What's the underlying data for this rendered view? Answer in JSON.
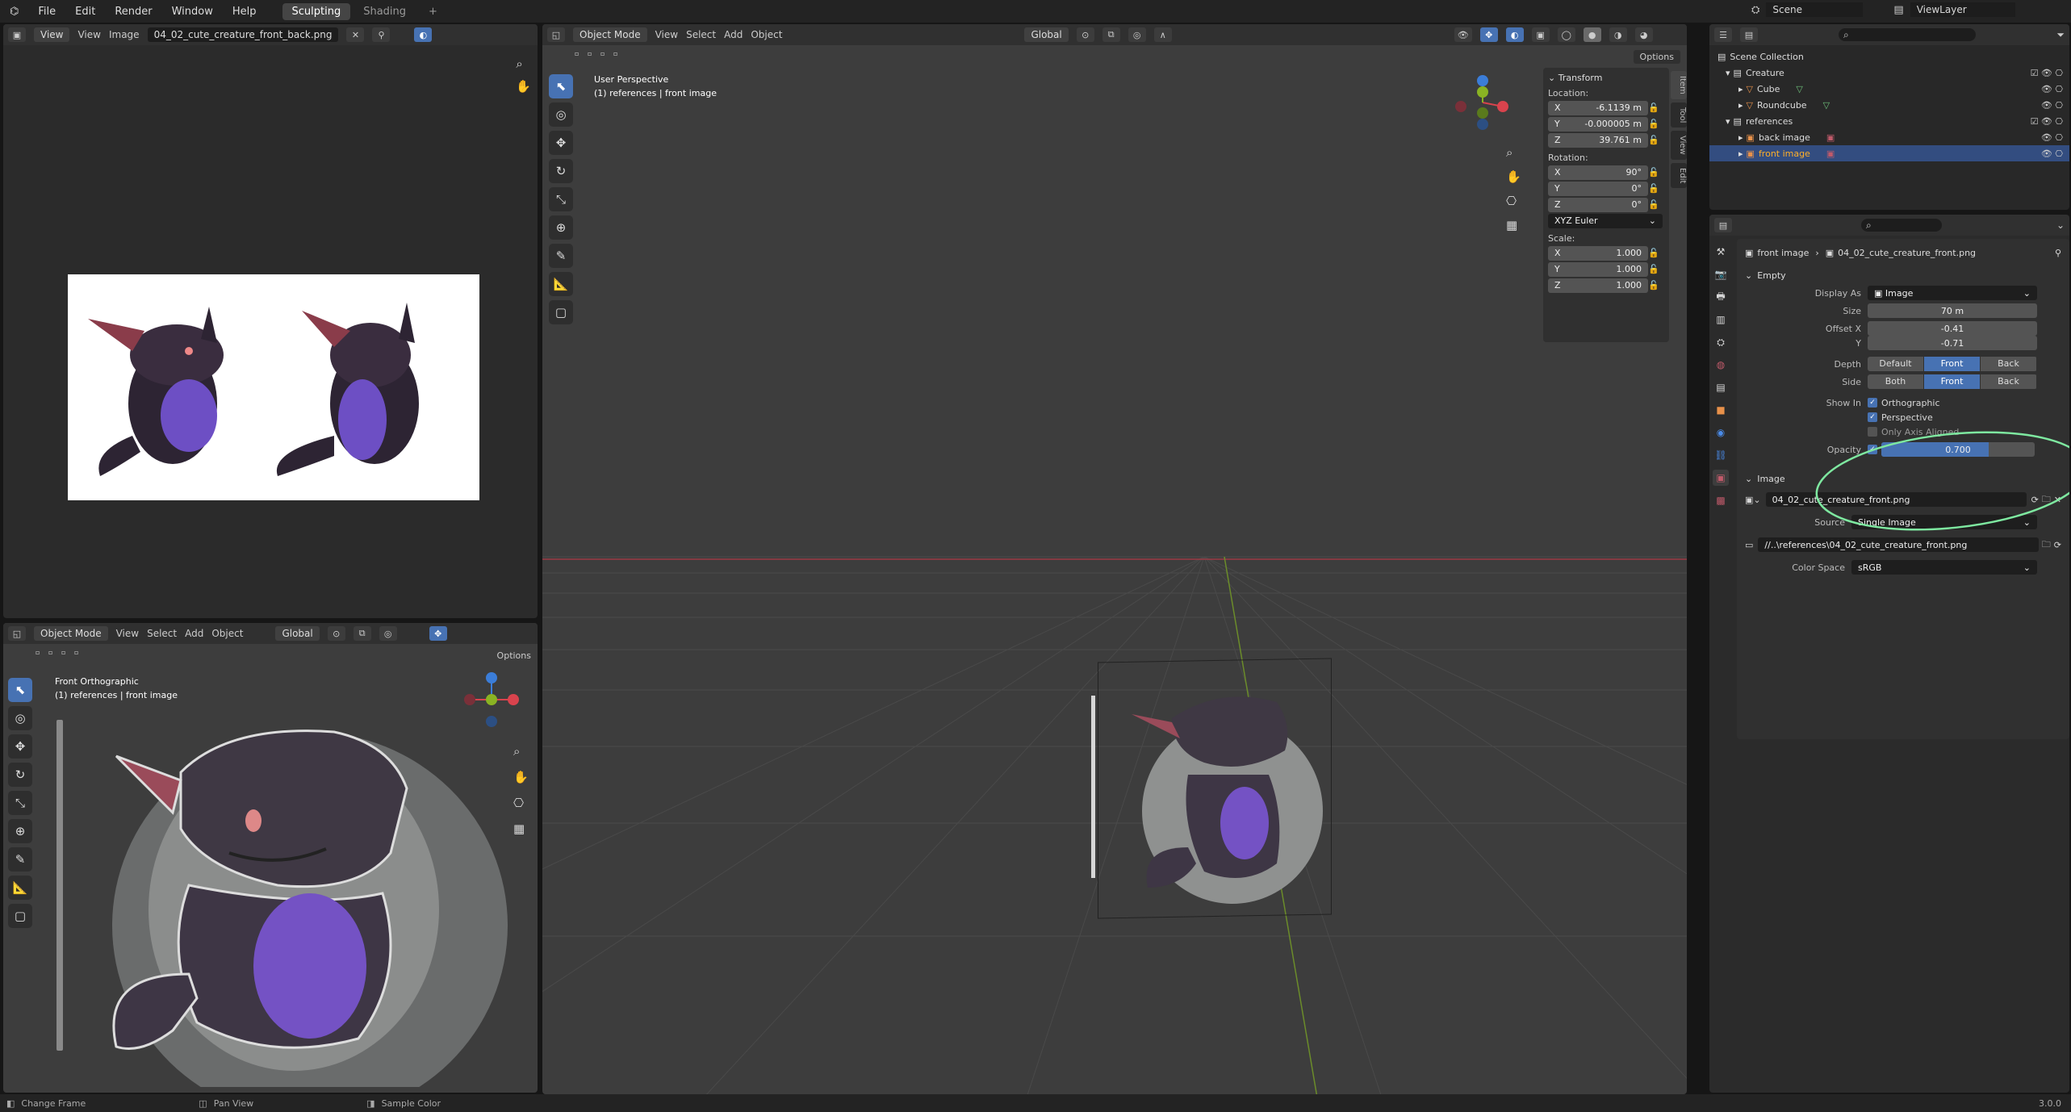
{
  "menu": [
    "File",
    "Edit",
    "Render",
    "Window",
    "Help"
  ],
  "workspaces": [
    {
      "label": "Sculpting",
      "active": true
    },
    {
      "label": "Shading",
      "active": false
    }
  ],
  "add_workspace": "+",
  "scene": {
    "label": "Scene"
  },
  "viewlayer": {
    "label": "ViewLayer"
  },
  "image_editor": {
    "menus": [
      "View",
      "View",
      "Image"
    ],
    "image_name": "04_02_cute_creature_front_back.png"
  },
  "front_viewport": {
    "mode": "Object Mode",
    "menus": [
      "View",
      "Select",
      "Add",
      "Object"
    ],
    "orientation": "Global",
    "options": "Options",
    "view_name": "Front Orthographic",
    "collection_info": "(1) references | front image"
  },
  "main_viewport": {
    "mode": "Object Mode",
    "menus": [
      "View",
      "Select",
      "Add",
      "Object"
    ],
    "orientation": "Global",
    "options": "Options",
    "view_name": "User Perspective",
    "collection_info": "(1) references | front image",
    "tabs": [
      "Item",
      "Tool",
      "View",
      "Edit"
    ]
  },
  "transform": {
    "title": "Transform",
    "location_label": "Location:",
    "location": [
      {
        "axis": "X",
        "value": "-6.1139 m"
      },
      {
        "axis": "Y",
        "value": "-0.000005 m"
      },
      {
        "axis": "Z",
        "value": "39.761 m"
      }
    ],
    "rotation_label": "Rotation:",
    "rotation": [
      {
        "axis": "X",
        "value": "90°"
      },
      {
        "axis": "Y",
        "value": "0°"
      },
      {
        "axis": "Z",
        "value": "0°"
      }
    ],
    "rotation_mode": "XYZ Euler",
    "scale_label": "Scale:",
    "scale": [
      {
        "axis": "X",
        "value": "1.000"
      },
      {
        "axis": "Y",
        "value": "1.000"
      },
      {
        "axis": "Z",
        "value": "1.000"
      }
    ]
  },
  "outliner": {
    "root": "Scene Collection",
    "items": [
      {
        "label": "Creature",
        "depth": 1,
        "type": "collection"
      },
      {
        "label": "Cube",
        "depth": 2,
        "type": "mesh"
      },
      {
        "label": "Roundcube",
        "depth": 2,
        "type": "mesh"
      },
      {
        "label": "references",
        "depth": 1,
        "type": "collection"
      },
      {
        "label": "back image",
        "depth": 2,
        "type": "image"
      },
      {
        "label": "front image",
        "depth": 2,
        "type": "image",
        "selected": true
      }
    ]
  },
  "properties": {
    "breadcrumb_object": "front image",
    "breadcrumb_data": "04_02_cute_creature_front.png",
    "empty_panel": "Empty",
    "display_as_label": "Display As",
    "display_as": "Image",
    "size_label": "Size",
    "size": "70 m",
    "offset_x_label": "Offset X",
    "offset_x": "-0.41",
    "offset_y_label": "Y",
    "offset_y": "-0.71",
    "depth_label": "Depth",
    "depth_options": [
      {
        "label": "Default",
        "on": false
      },
      {
        "label": "Front",
        "on": true
      },
      {
        "label": "Back",
        "on": false
      }
    ],
    "side_label": "Side",
    "side_options": [
      {
        "label": "Both",
        "on": false
      },
      {
        "label": "Front",
        "on": true
      },
      {
        "label": "Back",
        "on": false
      }
    ],
    "show_in_label": "Show In",
    "show_in": [
      {
        "label": "Orthographic",
        "checked": true
      },
      {
        "label": "Perspective",
        "checked": true
      },
      {
        "label": "Only Axis Aligned",
        "checked": false
      }
    ],
    "opacity_label": "Opacity",
    "opacity": "0.700",
    "opacity_fraction": 0.7,
    "image_panel": "Image",
    "image_name": "04_02_cute_creature_front.png",
    "source_label": "Source",
    "source": "Single Image",
    "filepath": "//..\\references\\04_02_cute_creature_front.png",
    "color_space_label": "Color Space",
    "color_space": "sRGB"
  },
  "status_bar": {
    "items": [
      "Change Frame",
      "Pan View",
      "Sample Color"
    ],
    "version": "3.0.0"
  },
  "colors": {
    "accent": "#4772b3",
    "highlight_circle": "#7ee8a0",
    "x_axis": "#d9434d",
    "y_axis": "#8ab323",
    "z_axis": "#3b7dd8"
  }
}
